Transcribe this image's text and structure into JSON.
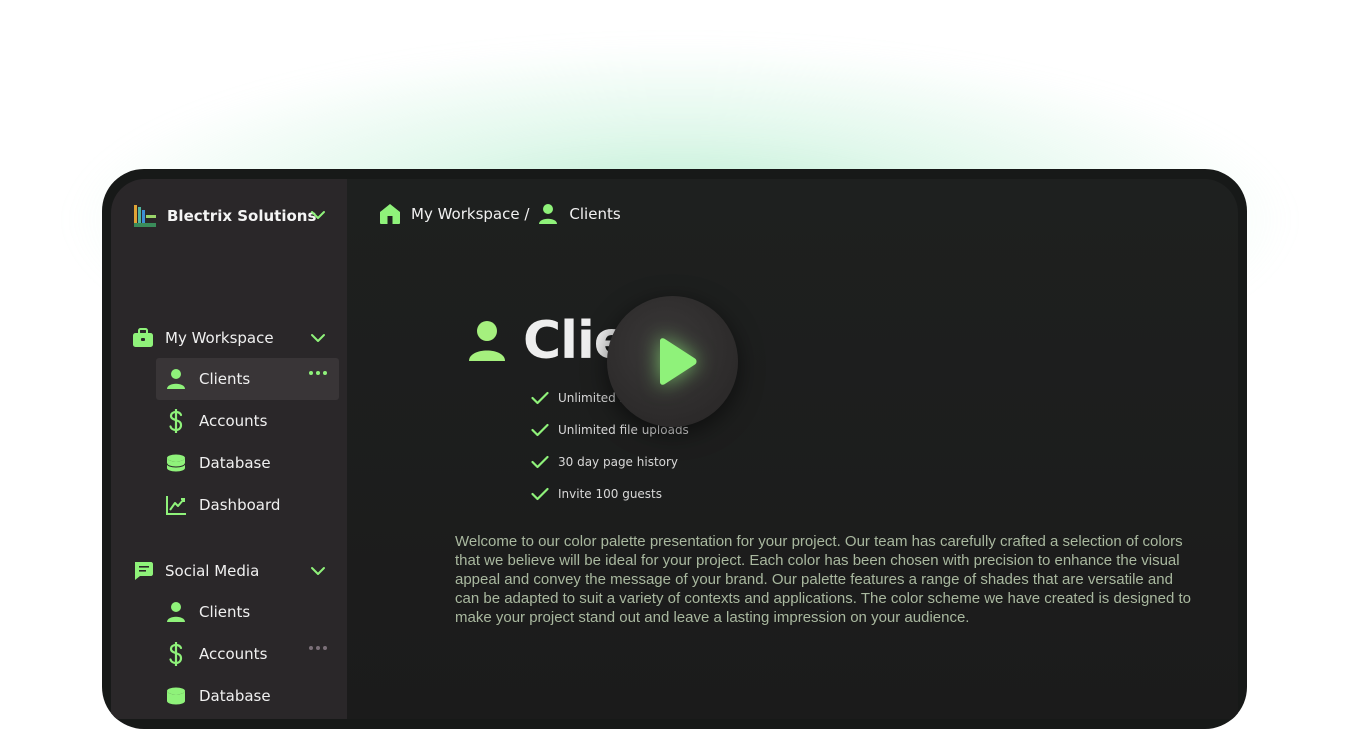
{
  "sidebar": {
    "org_name": "Blectrix Solutions",
    "groups": [
      {
        "label": "My Workspace",
        "icon": "briefcase-icon",
        "items": [
          {
            "label": "Clients",
            "icon": "user-icon",
            "active": true
          },
          {
            "label": "Accounts",
            "icon": "dollar-icon"
          },
          {
            "label": "Database",
            "icon": "database-icon"
          },
          {
            "label": "Dashboard",
            "icon": "chart-icon"
          }
        ]
      },
      {
        "label": "Social Media",
        "icon": "chat-icon",
        "items": [
          {
            "label": "Clients",
            "icon": "user-icon"
          },
          {
            "label": "Accounts",
            "icon": "dollar-icon"
          },
          {
            "label": "Database",
            "icon": "database-icon"
          }
        ]
      }
    ]
  },
  "breadcrumb": {
    "home": "My Workspace /",
    "current": "Clients"
  },
  "page": {
    "title": "Clients",
    "features": [
      "Unlimited block usage",
      "Unlimited file uploads",
      "30 day page history",
      "Invite 100 guests"
    ],
    "description": "Welcome to our color palette presentation for your project. Our team has carefully crafted a selection of colors that we believe will be ideal for your project. Each color has been chosen with precision to enhance the visual appeal and convey the message of your brand. Our palette features a range of shades that are versatile and can be adapted to suit a variety of contexts and applications. The color scheme we have created is designed to make your project stand out and leave a lasting impression on your audience."
  },
  "colors": {
    "accent": "#8ff27a",
    "sidebar_bg": "#2a2729",
    "main_bg": "#1c1c1c",
    "glow": "#80deaa"
  }
}
